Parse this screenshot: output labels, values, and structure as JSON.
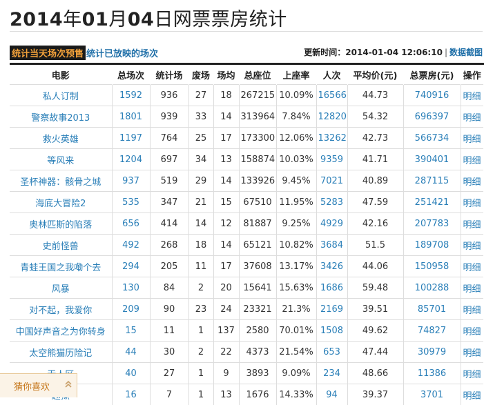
{
  "title": {
    "year": "2014",
    "y_char": "年",
    "month": "01",
    "m_char": "月",
    "day": "04",
    "rest": "日网票票房统计"
  },
  "tabs": {
    "active": "统计当天场次预售",
    "other": "统计已放映的场次"
  },
  "update": {
    "label": "更新时间：",
    "time": "2014-01-04 12:06:10",
    "separator": "|",
    "screenshot_link": "数据截图"
  },
  "table": {
    "headers": [
      "电影",
      "总场次",
      "统计场",
      "废场",
      "场均",
      "总座位",
      "上座率",
      "人次",
      "平均价(元)",
      "总票房(元)",
      "操作"
    ],
    "rows": [
      [
        "私人订制",
        "1592",
        "936",
        "27",
        "18",
        "267215",
        "10.09%",
        "16566",
        "44.73",
        "740916",
        "明细"
      ],
      [
        "警察故事2013",
        "1801",
        "939",
        "33",
        "14",
        "313964",
        "7.84%",
        "12820",
        "54.32",
        "696397",
        "明细"
      ],
      [
        "救火英雄",
        "1197",
        "764",
        "25",
        "17",
        "173300",
        "12.06%",
        "13262",
        "42.73",
        "566734",
        "明细"
      ],
      [
        "等风来",
        "1204",
        "697",
        "34",
        "13",
        "158874",
        "10.03%",
        "9359",
        "41.71",
        "390401",
        "明细"
      ],
      [
        "圣杯神器：骸骨之城",
        "937",
        "519",
        "29",
        "14",
        "133926",
        "9.45%",
        "7021",
        "40.89",
        "287115",
        "明细"
      ],
      [
        "海底大冒险2",
        "535",
        "347",
        "21",
        "15",
        "67510",
        "11.95%",
        "5283",
        "47.59",
        "251421",
        "明细"
      ],
      [
        "奥林匹斯的陷落",
        "656",
        "414",
        "14",
        "12",
        "81887",
        "9.25%",
        "4929",
        "42.16",
        "207783",
        "明细"
      ],
      [
        "史前怪兽",
        "492",
        "268",
        "18",
        "14",
        "65121",
        "10.82%",
        "3684",
        "51.5",
        "189708",
        "明细"
      ],
      [
        "青蛙王国之我嘞个去",
        "294",
        "205",
        "11",
        "17",
        "37608",
        "13.17%",
        "3426",
        "44.06",
        "150958",
        "明细"
      ],
      [
        "风暴",
        "130",
        "84",
        "2",
        "20",
        "15641",
        "15.63%",
        "1686",
        "59.48",
        "100288",
        "明细"
      ],
      [
        "对不起，我爱你",
        "209",
        "90",
        "23",
        "24",
        "23321",
        "21.3%",
        "2169",
        "39.51",
        "85701",
        "明细"
      ],
      [
        "中国好声音之为你转身",
        "15",
        "11",
        "1",
        "137",
        "2580",
        "70.01%",
        "1508",
        "49.62",
        "74827",
        "明细"
      ],
      [
        "太空熊猫历险记",
        "44",
        "30",
        "2",
        "22",
        "4373",
        "21.54%",
        "653",
        "47.44",
        "30979",
        "明细"
      ],
      [
        "无人区",
        "40",
        "27",
        "1",
        "9",
        "3893",
        "9.09%",
        "234",
        "48.66",
        "11386",
        "明细"
      ],
      [
        "越狱",
        "16",
        "7",
        "1",
        "13",
        "1676",
        "14.33%",
        "94",
        "39.37",
        "3701",
        "明细"
      ]
    ]
  },
  "guess": {
    "label": "猜你喜欢",
    "icon": "double-chevron-up-icon"
  }
}
